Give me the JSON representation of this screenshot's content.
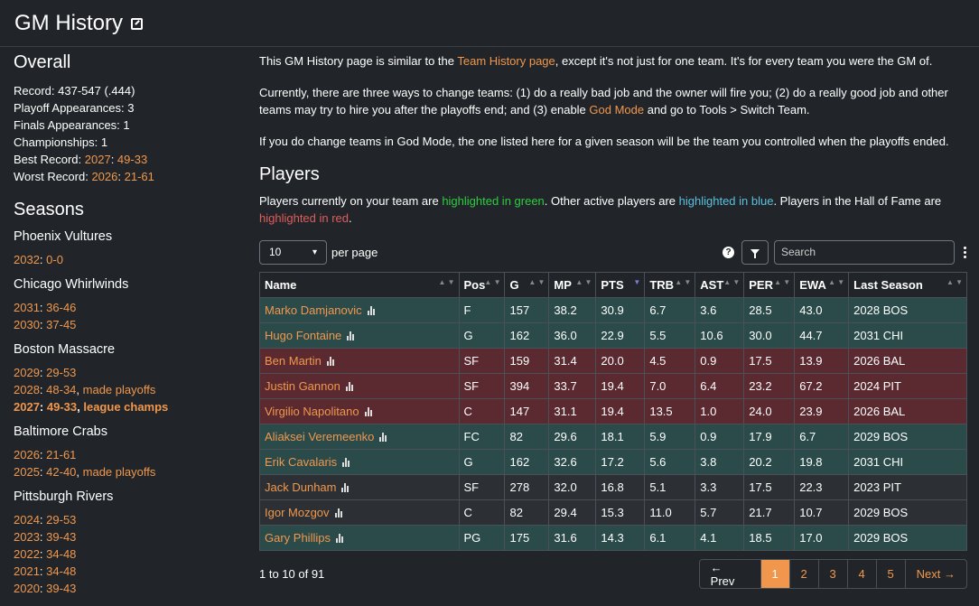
{
  "header": {
    "title": "GM History"
  },
  "overall": {
    "title": "Overall",
    "record": "Record: 437-547 (.444)",
    "playoff_appearances": "Playoff Appearances: 3",
    "finals_appearances": "Finals Appearances: 1",
    "championships": "Championships: 1",
    "best_label": "Best Record: ",
    "best_year": "2027",
    "best_record": "49-33",
    "worst_label": "Worst Record: ",
    "worst_year": "2026",
    "worst_record": "21-61"
  },
  "seasons_title": "Seasons",
  "teams": [
    {
      "name": "Phoenix Vultures",
      "seasons": [
        {
          "year": "2032",
          "record": "0-0",
          "note": "",
          "bold": false
        }
      ]
    },
    {
      "name": "Chicago Whirlwinds",
      "seasons": [
        {
          "year": "2031",
          "record": "36-46",
          "note": "",
          "bold": false
        },
        {
          "year": "2030",
          "record": "37-45",
          "note": "",
          "bold": false
        }
      ]
    },
    {
      "name": "Boston Massacre",
      "seasons": [
        {
          "year": "2029",
          "record": "29-53",
          "note": "",
          "bold": false
        },
        {
          "year": "2028",
          "record": "48-34",
          "note": "made playoffs",
          "bold": false
        },
        {
          "year": "2027",
          "record": "49-33",
          "note": "league champs",
          "bold": true
        }
      ]
    },
    {
      "name": "Baltimore Crabs",
      "seasons": [
        {
          "year": "2026",
          "record": "21-61",
          "note": "",
          "bold": false
        },
        {
          "year": "2025",
          "record": "42-40",
          "note": "made playoffs",
          "bold": false
        }
      ]
    },
    {
      "name": "Pittsburgh Rivers",
      "seasons": [
        {
          "year": "2024",
          "record": "29-53",
          "note": "",
          "bold": false
        },
        {
          "year": "2023",
          "record": "39-43",
          "note": "",
          "bold": false
        },
        {
          "year": "2022",
          "record": "34-48",
          "note": "",
          "bold": false
        },
        {
          "year": "2021",
          "record": "34-48",
          "note": "",
          "bold": false
        },
        {
          "year": "2020",
          "record": "39-43",
          "note": "",
          "bold": false
        }
      ]
    }
  ],
  "intro": {
    "p1_a": "This GM History page is similar to the ",
    "p1_link": "Team History page",
    "p1_b": ", except it's not just for one team. It's for every team you were the GM of.",
    "p2_a": "Currently, there are three ways to change teams: (1) do a really bad job and the owner will fire you; (2) do a really good job and other teams may try to hire you after the playoffs end; and (3) enable ",
    "p2_link": "God Mode",
    "p2_b": " and go to Tools > Switch Team.",
    "p3": "If you do change teams in God Mode, the one listed here for a given season will be the team you controlled when the playoffs ended."
  },
  "players": {
    "title": "Players",
    "legend_a": "Players currently on your team are ",
    "legend_green": "highlighted in green",
    "legend_b": ". Other active players are ",
    "legend_blue": "highlighted in blue",
    "legend_c": ". Players in the Hall of Fame are ",
    "legend_red": "highlighted in red",
    "legend_d": "."
  },
  "controls": {
    "per_page_value": "10",
    "per_page_label": "per page",
    "search_placeholder": "Search",
    "help_icon": "question-circle-icon",
    "filter_icon": "filter-icon",
    "menu_icon": "kebab-menu-icon"
  },
  "table": {
    "columns": [
      "Name",
      "Pos",
      "G",
      "MP",
      "PTS",
      "TRB",
      "AST",
      "PER",
      "EWA",
      "Last Season"
    ],
    "sorted_column": "PTS",
    "rows": [
      {
        "highlight": "green",
        "cells": [
          "Marko Damjanovic",
          "F",
          "157",
          "38.2",
          "30.9",
          "6.7",
          "3.6",
          "28.5",
          "43.0",
          "2028 BOS"
        ]
      },
      {
        "highlight": "green",
        "cells": [
          "Hugo Fontaine",
          "G",
          "162",
          "36.0",
          "22.9",
          "5.5",
          "10.6",
          "30.0",
          "44.7",
          "2031 CHI"
        ]
      },
      {
        "highlight": "red",
        "cells": [
          "Ben Martin",
          "SF",
          "159",
          "31.4",
          "20.0",
          "4.5",
          "0.9",
          "17.5",
          "13.9",
          "2026 BAL"
        ]
      },
      {
        "highlight": "red",
        "cells": [
          "Justin Gannon",
          "SF",
          "394",
          "33.7",
          "19.4",
          "7.0",
          "6.4",
          "23.2",
          "67.2",
          "2024 PIT"
        ]
      },
      {
        "highlight": "red",
        "cells": [
          "Virgilio Napolitano",
          "C",
          "147",
          "31.1",
          "19.4",
          "13.5",
          "1.0",
          "24.0",
          "23.9",
          "2026 BAL"
        ]
      },
      {
        "highlight": "green",
        "cells": [
          "Aliaksei Veremeenko",
          "FC",
          "82",
          "29.6",
          "18.1",
          "5.9",
          "0.9",
          "17.9",
          "6.7",
          "2029 BOS"
        ]
      },
      {
        "highlight": "green",
        "cells": [
          "Erik Cavalaris",
          "G",
          "162",
          "32.6",
          "17.2",
          "5.6",
          "3.8",
          "20.2",
          "19.8",
          "2031 CHI"
        ]
      },
      {
        "highlight": "plain",
        "cells": [
          "Jack Dunham",
          "SF",
          "278",
          "32.0",
          "16.8",
          "5.1",
          "3.3",
          "17.5",
          "22.3",
          "2023 PIT"
        ]
      },
      {
        "highlight": "plain",
        "cells": [
          "Igor Mozgov",
          "C",
          "82",
          "29.4",
          "15.3",
          "11.0",
          "5.7",
          "21.7",
          "10.7",
          "2029 BOS"
        ]
      },
      {
        "highlight": "green",
        "cells": [
          "Gary Phillips",
          "PG",
          "175",
          "31.6",
          "14.3",
          "6.1",
          "4.1",
          "18.5",
          "17.0",
          "2029 BOS"
        ]
      }
    ]
  },
  "pagination": {
    "summary": "1 to 10 of 91",
    "prev": "← Prev",
    "pages": [
      "1",
      "2",
      "3",
      "4",
      "5"
    ],
    "active_page": "1",
    "next": "Next →"
  }
}
